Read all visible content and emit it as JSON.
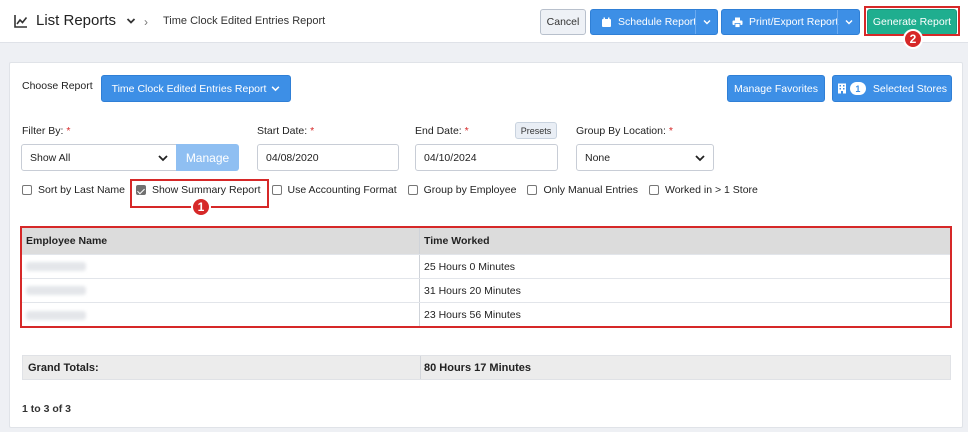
{
  "header": {
    "title": "List Reports",
    "breadcrumb": "Time Clock Edited Entries Report",
    "cancel_label": "Cancel",
    "schedule_label": "Schedule Report",
    "print_label": "Print/Export Report",
    "generate_label": "Generate Report"
  },
  "report": {
    "choose_label": "Choose Report",
    "selected_report": "Time Clock Edited Entries Report",
    "manage_favorites_label": "Manage Favorites",
    "stores_count": "1",
    "stores_label": "Selected Stores"
  },
  "filters": {
    "filter_by_label": "Filter By:",
    "filter_by_value": "Show All",
    "manage_label": "Manage",
    "start_date_label": "Start Date:",
    "start_date_value": "04/08/2020",
    "end_date_label": "End Date:",
    "end_date_value": "04/10/2024",
    "presets_label": "Presets",
    "group_by_location_label": "Group By Location:",
    "group_by_location_value": "None",
    "required_mark": "*"
  },
  "options": [
    {
      "label": "Sort by Last Name",
      "checked": false
    },
    {
      "label": "Show Summary Report",
      "checked": true
    },
    {
      "label": "Use Accounting Format",
      "checked": false
    },
    {
      "label": "Group by Employee",
      "checked": false
    },
    {
      "label": "Only Manual Entries",
      "checked": false
    },
    {
      "label": "Worked in > 1 Store",
      "checked": false
    }
  ],
  "table": {
    "columns": [
      "Employee Name",
      "Time Worked"
    ],
    "rows": [
      {
        "time": "25 Hours 0 Minutes"
      },
      {
        "time": "31 Hours 20 Minutes"
      },
      {
        "time": "23 Hours 56 Minutes"
      }
    ]
  },
  "totals": {
    "label": "Grand Totals:",
    "value": "80 Hours 17 Minutes"
  },
  "pager": "1 to 3 of 3",
  "callouts": [
    "1",
    "2"
  ],
  "colors": {
    "primary": "#3d8fe6",
    "generate": "#1fae8f",
    "highlight": "#d62828"
  }
}
